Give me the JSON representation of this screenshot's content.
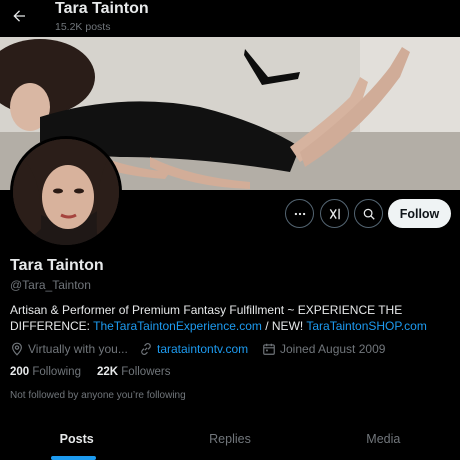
{
  "header": {
    "name": "Tara Tainton",
    "posts_count": "15.2K posts"
  },
  "profile": {
    "name": "Tara Tainton",
    "handle": "@Tara_Tainton",
    "bio_text_1": "Artisan & Performer of Premium Fantasy Fulfillment ~ EXPERIENCE THE DIFFERENCE: ",
    "bio_link_1": "TheTaraTaintonExperience.com",
    "bio_text_2": " / NEW! ",
    "bio_link_2": "TaraTaintonSHOP.com",
    "location": "Virtually with you...",
    "website": "tarataintontv.com",
    "joined": "Joined August 2009"
  },
  "stats": {
    "following_count": "200",
    "following_label": "Following",
    "followers_count": "22K",
    "followers_label": "Followers"
  },
  "not_followed_text": "Not followed by anyone you’re following",
  "actions": {
    "follow_label": "Follow",
    "more_icon": "more-icon",
    "grok_icon": "grok-icon",
    "search_icon": "search-icon"
  },
  "tabs": [
    {
      "label": "Posts",
      "active": true
    },
    {
      "label": "Replies",
      "active": false
    },
    {
      "label": "Media",
      "active": false
    }
  ],
  "colors": {
    "background": "#000000",
    "accent": "#1d9bf0",
    "muted": "#71767b",
    "text": "#e7e9ea"
  }
}
